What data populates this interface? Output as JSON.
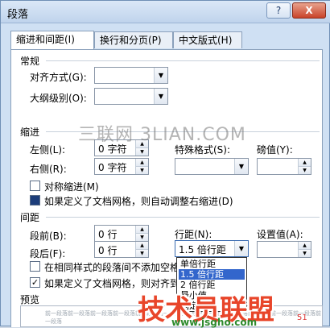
{
  "window": {
    "title": "段落",
    "help_label": "?",
    "close_label": "X"
  },
  "tabs": [
    {
      "label": "缩进和间距(I)",
      "active": true
    },
    {
      "label": "换行和分页(P)",
      "active": false
    },
    {
      "label": "中文版式(H)",
      "active": false
    }
  ],
  "general": {
    "section_label": "常规",
    "alignment_label": "对齐方式(G):",
    "alignment_value": "",
    "outline_label": "大纲级别(O):",
    "outline_value": ""
  },
  "indent": {
    "section_label": "缩进",
    "left_label": "左侧(L):",
    "left_value": "0 字符",
    "right_label": "右侧(R):",
    "right_value": "0 字符",
    "special_label": "特殊格式(S):",
    "special_value": "",
    "by_label": "磅值(Y):",
    "by_value": "",
    "mirror_label": "对称缩进(M)",
    "mirror_checked": false,
    "auto_adjust_label": "如果定义了文档网格，则自动调整右缩进(D)",
    "auto_adjust_checked": true
  },
  "spacing": {
    "section_label": "间距",
    "before_label": "段前(B):",
    "before_value": "0 行",
    "after_label": "段后(F):",
    "after_value": "0 行",
    "line_spacing_label": "行距(N):",
    "line_spacing_value": "1.5 倍行距",
    "at_label": "设置值(A):",
    "at_value": "",
    "no_space_label": "在相同样式的段落间不添加空格(C)",
    "no_space_checked": false,
    "snap_grid_label": "如果定义了文档网格，则对齐到网格(W)",
    "snap_grid_checked": true,
    "line_spacing_options": [
      "单倍行距",
      "1.5 倍行距",
      "2 倍行距",
      "最小值",
      "固定值"
    ],
    "line_spacing_selected_index": 1
  },
  "preview": {
    "section_label": "预览",
    "sample_text": "前一段落前一段落前一段落前一段落前一段落前一段落前一段落前一段落前一段落前一段落前一段落前一段落前一段落"
  },
  "watermarks": {
    "top_text": "三联网 3LIAN.COM",
    "bottom_text_cn": "技术员联盟",
    "bottom_url": "www.jsgho.com",
    "bottom_tag": "51"
  },
  "colors": {
    "selection": "#3366cc",
    "window_frame": "#cfe0f3",
    "close_button": "#c9432a",
    "watermark_red": "#e8452a",
    "watermark_green": "#2e8b2e"
  }
}
